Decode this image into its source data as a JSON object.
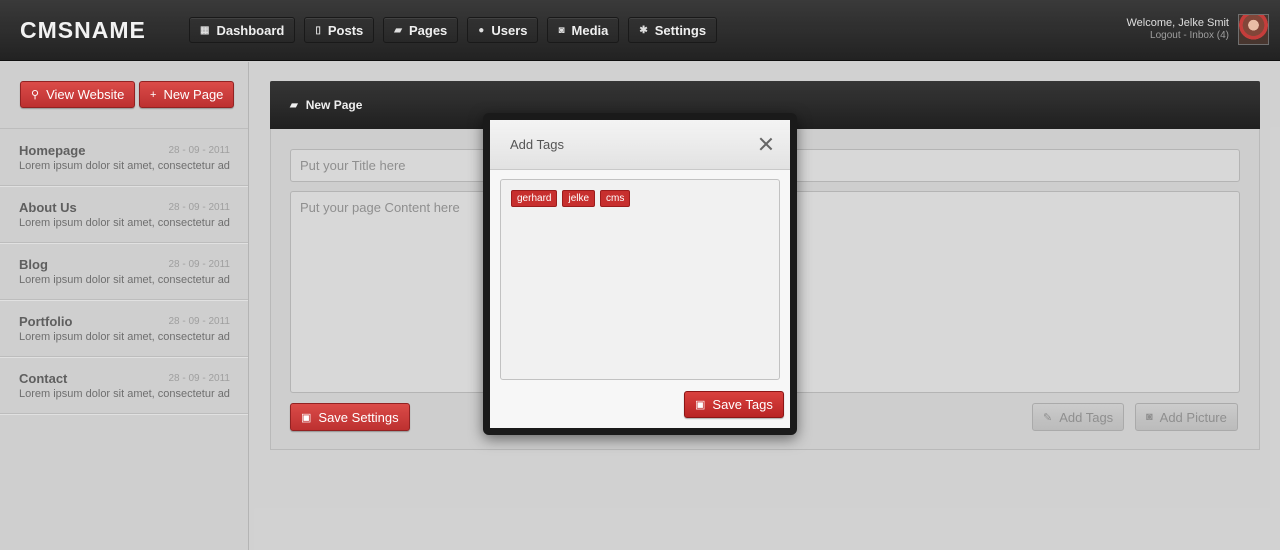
{
  "app": {
    "name": "CMSNAME"
  },
  "nav": [
    {
      "icon": "calendar-icon",
      "glyph": "▦",
      "label": "Dashboard"
    },
    {
      "icon": "document-icon",
      "glyph": "▯",
      "label": "Posts"
    },
    {
      "icon": "folder-icon",
      "glyph": "▰",
      "label": "Pages"
    },
    {
      "icon": "user-icon",
      "glyph": "●",
      "label": "Users"
    },
    {
      "icon": "camera-icon",
      "glyph": "◙",
      "label": "Media"
    },
    {
      "icon": "gear-icon",
      "glyph": "✱",
      "label": "Settings"
    }
  ],
  "user": {
    "welcome": "Welcome, Jelke Smit",
    "logout": "Logout",
    "separator": " - ",
    "inbox": "Inbox (4)"
  },
  "sidebar": {
    "view_website": "View Website",
    "new_page": "New Page",
    "pages": [
      {
        "title": "Homepage",
        "date": "28 - 09 - 2011",
        "desc": "Lorem ipsum dolor sit amet, consectetur ad"
      },
      {
        "title": "About Us",
        "date": "28 - 09 - 2011",
        "desc": "Lorem ipsum dolor sit amet, consectetur ad"
      },
      {
        "title": "Blog",
        "date": "28 - 09 - 2011",
        "desc": "Lorem ipsum dolor sit amet, consectetur ad"
      },
      {
        "title": "Portfolio",
        "date": "28 - 09 - 2011",
        "desc": "Lorem ipsum dolor sit amet, consectetur ad"
      },
      {
        "title": "Contact",
        "date": "28 - 09 - 2011",
        "desc": "Lorem ipsum dolor sit amet, consectetur ad"
      }
    ]
  },
  "editor": {
    "header": "New Page",
    "title_placeholder": "Put your Title here",
    "content_placeholder": "Put your page Content here",
    "save_settings": "Save Settings",
    "add_tags": "Add Tags",
    "add_picture": "Add Picture"
  },
  "modal": {
    "title": "Add Tags",
    "tags": [
      "gerhard",
      "jelke",
      "cms"
    ],
    "save_tags": "Save Tags"
  },
  "colors": {
    "accent_red": "#c72f2e",
    "topbar": "#1b1b1b",
    "panel_bg": "#cbcbcb"
  }
}
